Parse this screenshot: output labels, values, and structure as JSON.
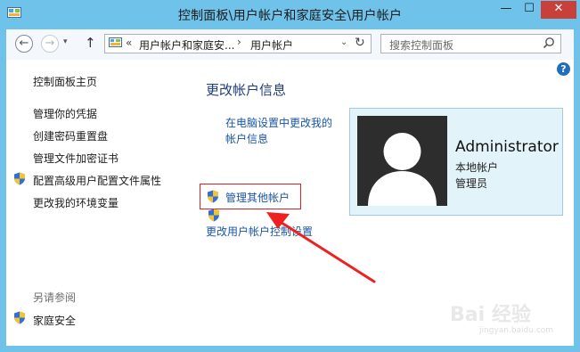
{
  "window": {
    "title": "控制面板\\用户帐户和家庭安全\\用户帐户",
    "minimize": "—",
    "maximize": "☐",
    "close": "✕"
  },
  "nav": {
    "back": "←",
    "forward": "→",
    "history": "▾",
    "up": "↑"
  },
  "address": {
    "chevron": "«",
    "crumbs": [
      "用户帐户和家庭安...",
      "用户帐户"
    ],
    "separator": "›",
    "dropdown": "⌄",
    "refresh": "↻"
  },
  "search": {
    "placeholder": "搜索控制面板"
  },
  "help": "?",
  "left_pane": {
    "home": "控制面板主页",
    "items": [
      "管理你的凭据",
      "创建密码重置盘",
      "管理文件加密证书",
      "配置高级用户配置文件属性",
      "更改我的环境变量"
    ],
    "see_also_header": "另请参阅",
    "see_also_items": [
      "家庭安全"
    ]
  },
  "main": {
    "heading": "更改帐户信息",
    "link_pc_settings": "在电脑设置中更改我的帐户信息",
    "link_manage_other": "管理其他帐户",
    "link_uac": "更改用户帐户控制设置"
  },
  "account": {
    "name": "Administrator",
    "type": "本地帐户",
    "role": "管理员"
  },
  "watermark": {
    "main": "Bai 经验",
    "sub": "jingyan.baidu.com"
  },
  "colors": {
    "titlebar": "#6fc3ea",
    "link": "#1a55a6",
    "heading": "#1f3d7a",
    "highlight": "#e02020",
    "account_panel": "#e3f3fa"
  }
}
